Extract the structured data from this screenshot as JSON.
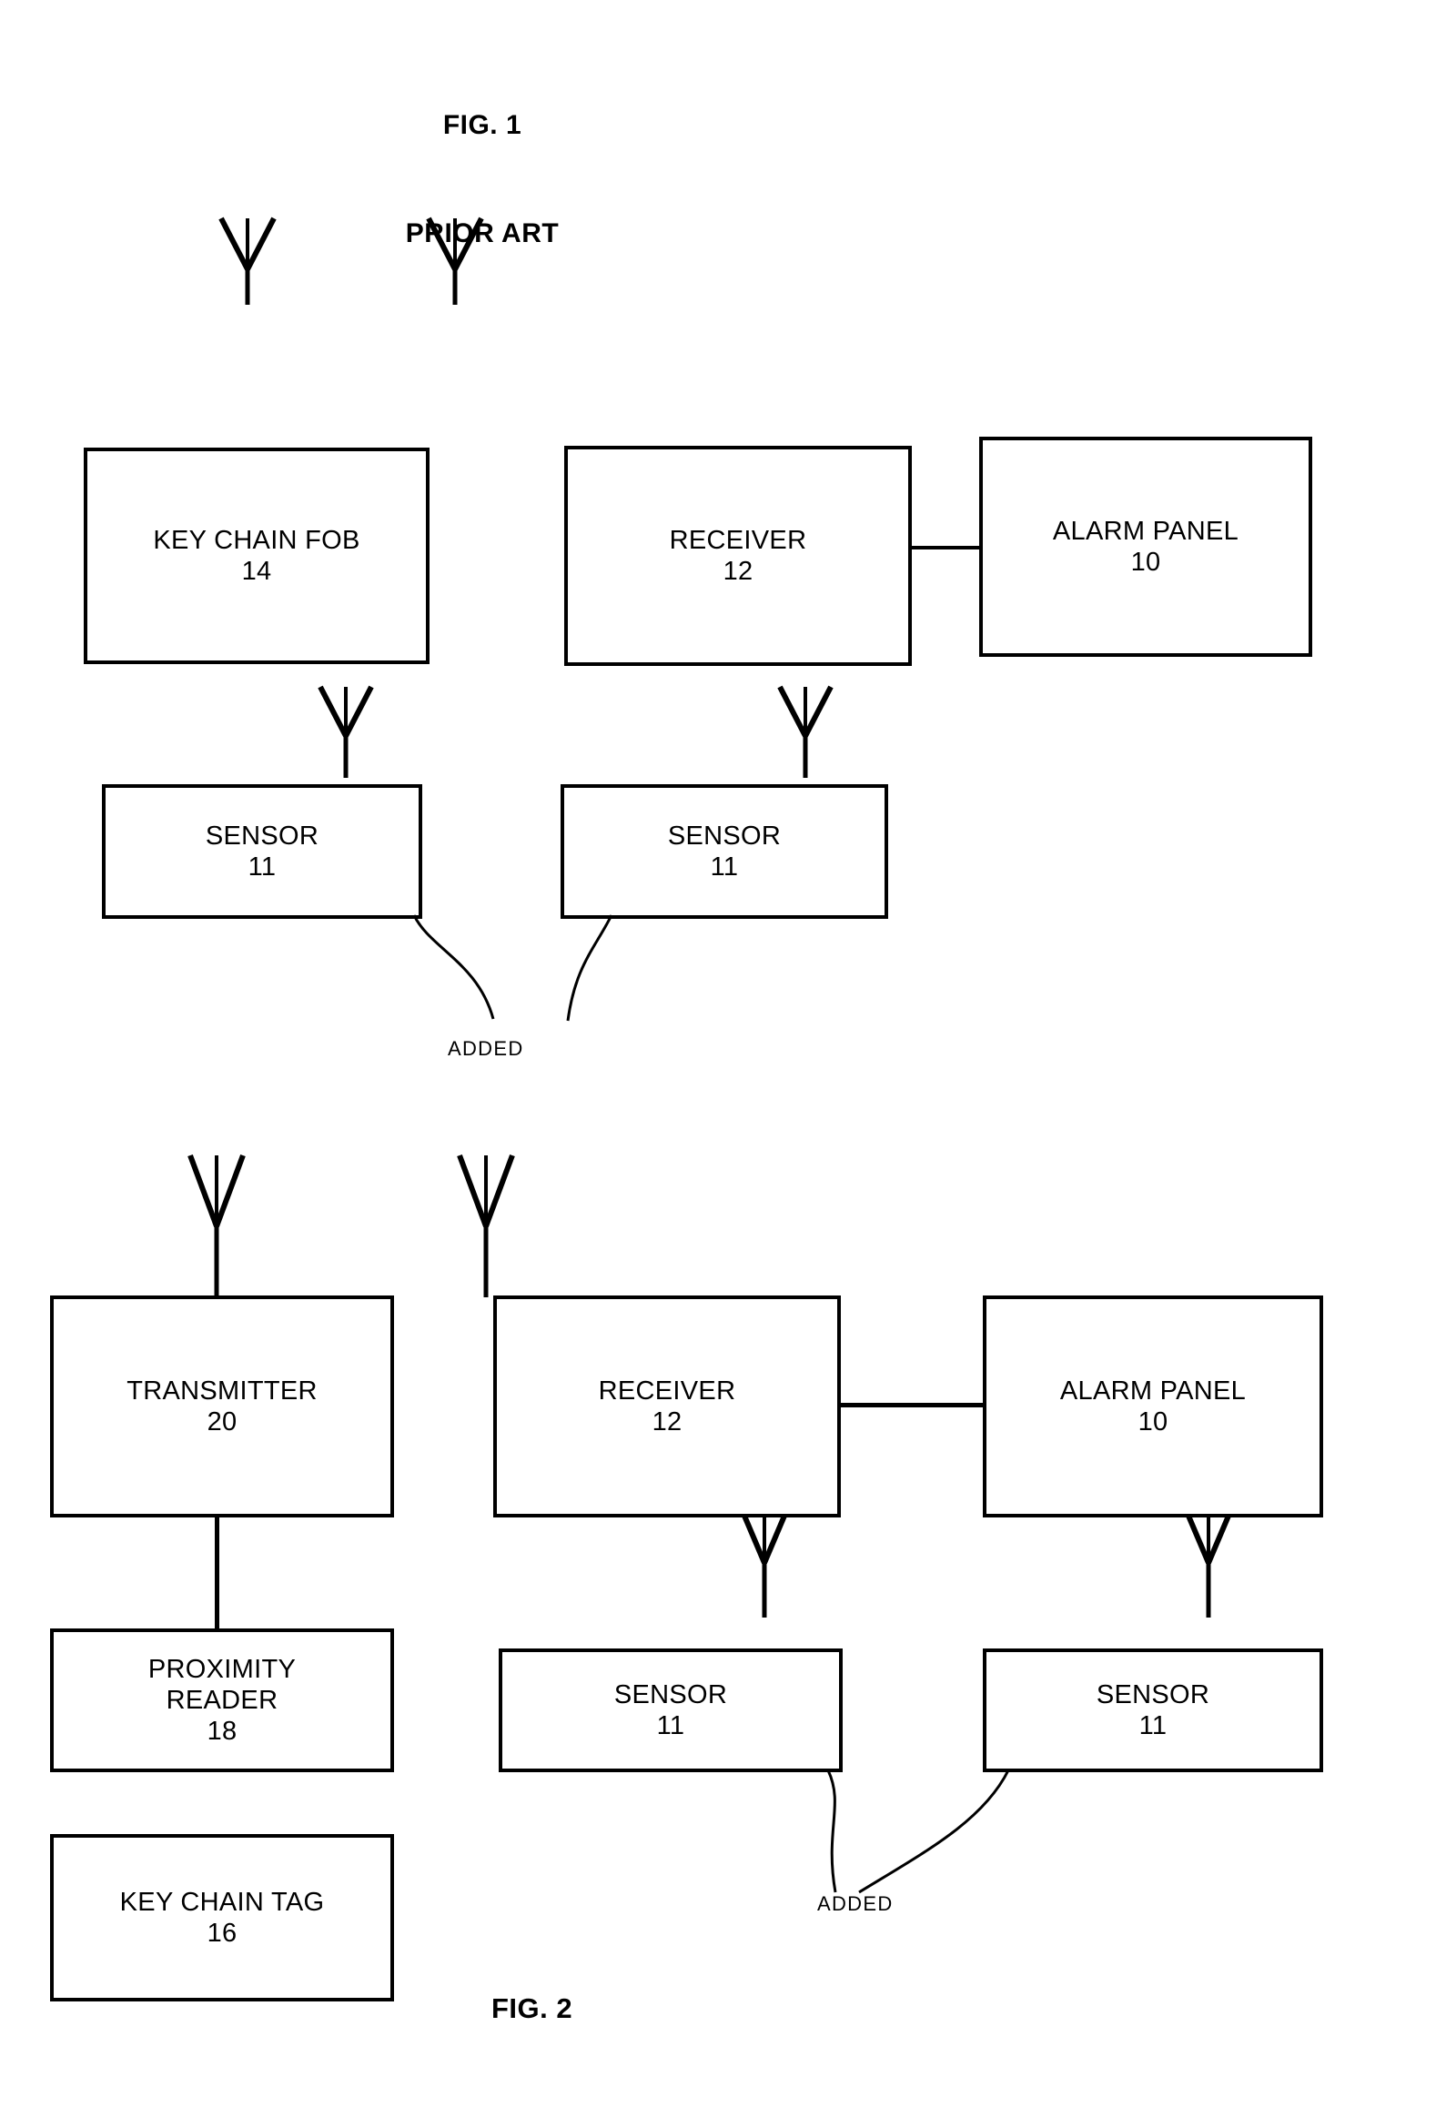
{
  "figures": [
    {
      "id": "fig1",
      "title_line1": "FIG. 1",
      "title_line2": "PRIOR ART",
      "annotation": "ADDED",
      "nodes": {
        "key_chain_fob": {
          "label": "KEY CHAIN FOB",
          "ref": "14"
        },
        "receiver": {
          "label": "RECEIVER",
          "ref": "12"
        },
        "alarm_panel": {
          "label": "ALARM PANEL",
          "ref": "10"
        },
        "sensor_left": {
          "label": "SENSOR",
          "ref": "11"
        },
        "sensor_right": {
          "label": "SENSOR",
          "ref": "11"
        }
      }
    },
    {
      "id": "fig2",
      "title_line1": "FIG. 2",
      "annotation": "ADDED",
      "nodes": {
        "transmitter": {
          "label": "TRANSMITTER",
          "ref": "20"
        },
        "proximity_reader": {
          "label_line1": "PROXIMITY",
          "label_line2": "READER",
          "ref": "18"
        },
        "key_chain_tag": {
          "label": "KEY CHAIN TAG",
          "ref": "16"
        },
        "receiver": {
          "label": "RECEIVER",
          "ref": "12"
        },
        "alarm_panel": {
          "label": "ALARM PANEL",
          "ref": "10"
        },
        "sensor_left": {
          "label": "SENSOR",
          "ref": "11"
        },
        "sensor_right": {
          "label": "SENSOR",
          "ref": "11"
        }
      }
    }
  ],
  "icons": {
    "antenna": "antenna-icon"
  },
  "colors": {
    "ink": "#000000",
    "paper": "#ffffff"
  }
}
